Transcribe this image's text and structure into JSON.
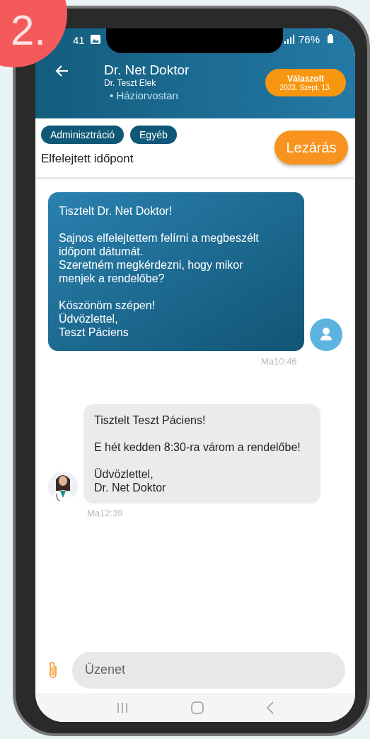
{
  "badge": {
    "text": "2."
  },
  "status_bar": {
    "time": "41",
    "battery": "76%"
  },
  "header": {
    "title": "Dr. Net Doktor",
    "doctor": "Dr. Teszt Elek",
    "specialty": "• Háziorvostan",
    "status": {
      "label": "Válaszolt",
      "date": "2023. Szept. 13."
    }
  },
  "tags": [
    "Adminisztráció",
    "Egyéb"
  ],
  "subject": "Elfelejtett időpont",
  "close_button": "Lezárás",
  "messages": [
    {
      "kind": "sent",
      "text": "Tisztelt Dr. Net Doktor!\n\nSajnos elfelejtettem felírni a megbeszélt időpont dátumát.\nSzeretném megkérdezni, hogy mikor menjek a rendelőbe?\n\nKöszönöm szépen!\nÜdvözlettel,\nTeszt Páciens",
      "time": "Ma10:46"
    },
    {
      "kind": "received",
      "text": "Tisztelt Teszt Páciens!\n\nE hét kedden 8:30-ra várom a rendelőbe!\n\nÜdvözlettel,\nDr. Net Doktor",
      "time": "Ma12:39"
    }
  ],
  "composer": {
    "placeholder": "Üzenet"
  }
}
